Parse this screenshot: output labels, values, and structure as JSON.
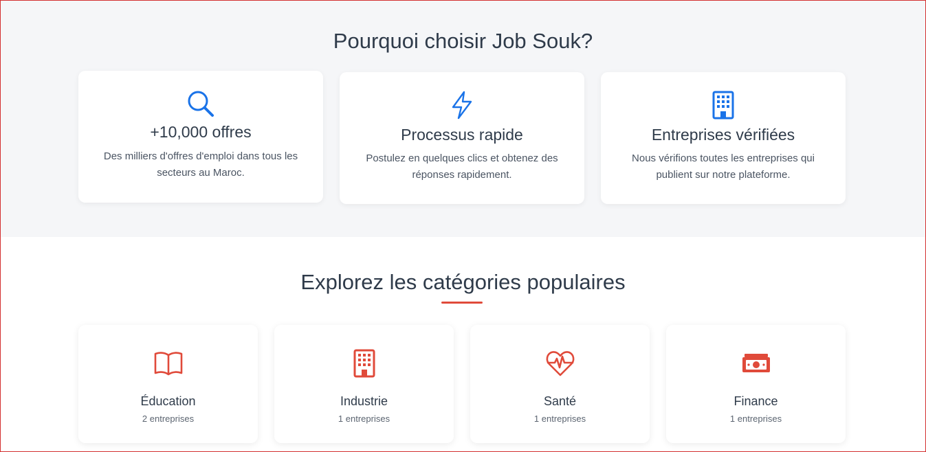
{
  "why_section": {
    "title": "Pourquoi choisir Job Souk?",
    "features": [
      {
        "icon": "search-icon",
        "title": "+10,000 offres",
        "description": "Des milliers d'offres d'emploi dans tous les secteurs au Maroc."
      },
      {
        "icon": "lightning-icon",
        "title": "Processus rapide",
        "description": "Postulez en quelques clics et obtenez des réponses rapidement."
      },
      {
        "icon": "building-icon",
        "title": "Entreprises vérifiées",
        "description": "Nous vérifions toutes les entreprises qui publient sur notre plateforme."
      }
    ]
  },
  "categories_section": {
    "title": "Explorez les catégories populaires",
    "categories": [
      {
        "icon": "book-icon",
        "name": "Éducation",
        "count": "2 entreprises"
      },
      {
        "icon": "building-icon",
        "name": "Industrie",
        "count": "1 entreprises"
      },
      {
        "icon": "heart-pulse-icon",
        "name": "Santé",
        "count": "1 entreprises"
      },
      {
        "icon": "money-icon",
        "name": "Finance",
        "count": "1 entreprises"
      }
    ]
  },
  "colors": {
    "feature_icon": "#1a73e8",
    "category_icon": "#e04a3a",
    "background": "#f5f6f8"
  }
}
